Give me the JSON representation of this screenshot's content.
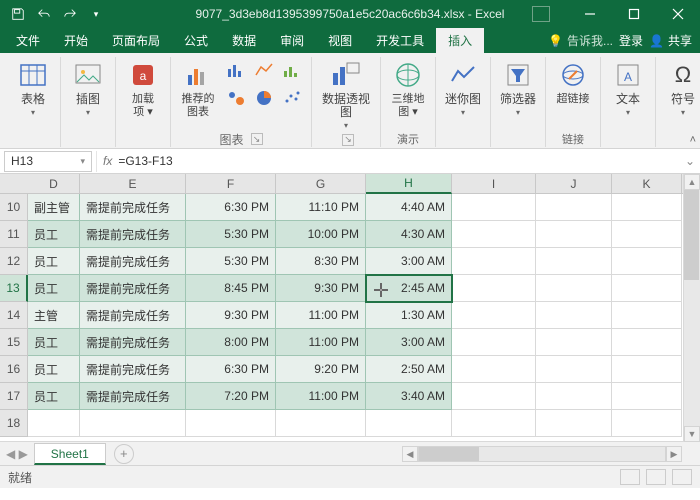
{
  "title": "9077_3d3eb8d1395399750a1e5c20ac6c6b34.xlsx - Excel",
  "tabs": [
    "文件",
    "开始",
    "页面布局",
    "公式",
    "数据",
    "审阅",
    "视图",
    "开发工具",
    "插入"
  ],
  "tell_me": "告诉我...",
  "login": "登录",
  "share": "共享",
  "ribbon": {
    "g1_btn": "表格",
    "g2_btn": "插图",
    "g3_btn1": "加载\n项 ▾",
    "g4_btn": "推荐的\n图表",
    "g4_label": "图表",
    "g5_btn": "数据透视图",
    "g6_btn": "三维地\n图 ▾",
    "g6_label": "演示",
    "g7_btn": "迷你图",
    "g8_btn": "筛选器",
    "g9_btn": "超链接",
    "g9_label": "链接",
    "g10_btn": "文本",
    "g11_btn": "符号"
  },
  "namebox": "H13",
  "formula": "=G13-F13",
  "columns": [
    "D",
    "E",
    "F",
    "G",
    "H",
    "I",
    "J",
    "K"
  ],
  "colClasses": [
    "cD",
    "cE",
    "cF",
    "cG",
    "cH",
    "cI",
    "cJ",
    "cK"
  ],
  "selectedCol": "H",
  "selectedRow": 13,
  "firstRow": 10,
  "rows": [
    {
      "n": 10,
      "d": "副主管",
      "e": "需提前完成任务",
      "f": "6:30 PM",
      "g": "11:10 PM",
      "h": "4:40 AM"
    },
    {
      "n": 11,
      "d": "员工",
      "e": "需提前完成任务",
      "f": "5:30 PM",
      "g": "10:00 PM",
      "h": "4:30 AM"
    },
    {
      "n": 12,
      "d": "员工",
      "e": "需提前完成任务",
      "f": "5:30 PM",
      "g": "8:30 PM",
      "h": "3:00 AM"
    },
    {
      "n": 13,
      "d": "员工",
      "e": "需提前完成任务",
      "f": "8:45 PM",
      "g": "9:30 PM",
      "h": "2:45 AM"
    },
    {
      "n": 14,
      "d": "主管",
      "e": "需提前完成任务",
      "f": "9:30 PM",
      "g": "11:00 PM",
      "h": "1:30 AM"
    },
    {
      "n": 15,
      "d": "员工",
      "e": "需提前完成任务",
      "f": "8:00 PM",
      "g": "11:00 PM",
      "h": "3:00 AM"
    },
    {
      "n": 16,
      "d": "员工",
      "e": "需提前完成任务",
      "f": "6:30 PM",
      "g": "9:20 PM",
      "h": "2:50 AM"
    },
    {
      "n": 17,
      "d": "员工",
      "e": "需提前完成任务",
      "f": "7:20 PM",
      "g": "11:00 PM",
      "h": "3:40 AM"
    },
    {
      "n": 18,
      "d": "",
      "e": "",
      "f": "",
      "g": "",
      "h": ""
    }
  ],
  "sheet": "Sheet1",
  "status": "就绪"
}
